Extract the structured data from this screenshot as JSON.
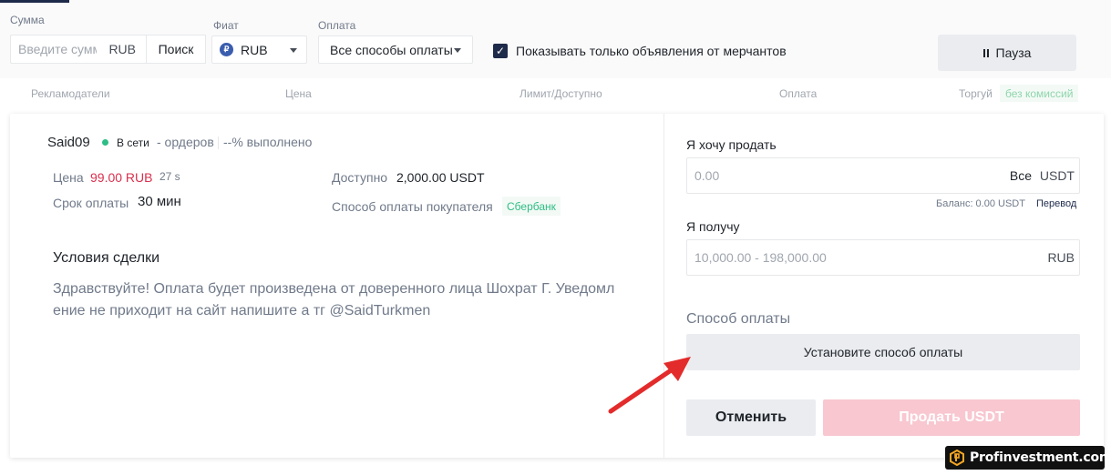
{
  "filters": {
    "amount_label": "Сумма",
    "amount_placeholder": "Введите сумм",
    "amount_currency": "RUB",
    "search_label": "Поиск",
    "fiat_label": "Фиат",
    "fiat_icon_glyph": "₽",
    "fiat_value": "RUB",
    "payment_label": "Оплата",
    "payment_value": "Все способы оплаты",
    "merchant_checkbox_label": "Показывать только объявления от мерчантов",
    "merchant_checked": true,
    "pause_label": "Пауза"
  },
  "columns": {
    "advertisers": "Рекламодатели",
    "price": "Цена",
    "limit": "Лимит/Доступно",
    "payment": "Оплата",
    "trade": "Торгуй",
    "fee_badge": "без комиссий"
  },
  "offer": {
    "name": "Said09",
    "status": "В сети",
    "orders": "- ордеров",
    "completion": "--% выполнено",
    "price_label": "Цена",
    "price_value": "99.00 RUB",
    "price_timer": "27 s",
    "available_label": "Доступно",
    "available_value": "2,000.00 USDT",
    "pay_time_label": "Срок оплаты",
    "pay_time_value": "30 мин",
    "buyer_method_label": "Способ оплаты покупателя",
    "buyer_method_value": "Сбербанк",
    "terms_title": "Условия сделки",
    "terms_text": "Здравствуйте! Оплата будет произведена от доверенного лица Шохрат Г. Уведомл ение не приходит на сайт напишите а тг @SaidTurkmen"
  },
  "trade_form": {
    "sell_label": "Я хочу продать",
    "sell_placeholder": "0.00",
    "sell_all": "Все",
    "sell_currency": "USDT",
    "balance": "Баланс: 0.00 USDT",
    "transfer": "Перевод",
    "receive_label": "Я получу",
    "receive_placeholder": "10,000.00 - 198,000.00",
    "receive_currency": "RUB",
    "payment_method_label": "Способ оплаты",
    "set_payment_button": "Установите способ оплаты",
    "cancel_button": "Отменить",
    "sell_button": "Продать USDT"
  },
  "watermark": {
    "text": "Profinvestment.com"
  },
  "colors": {
    "accent_navy": "#1e2a4a",
    "price_red": "#d9304e",
    "online_green": "#2ebd85",
    "sell_button_pink": "#f8c7d0",
    "arrow_red": "#e32b2b"
  }
}
